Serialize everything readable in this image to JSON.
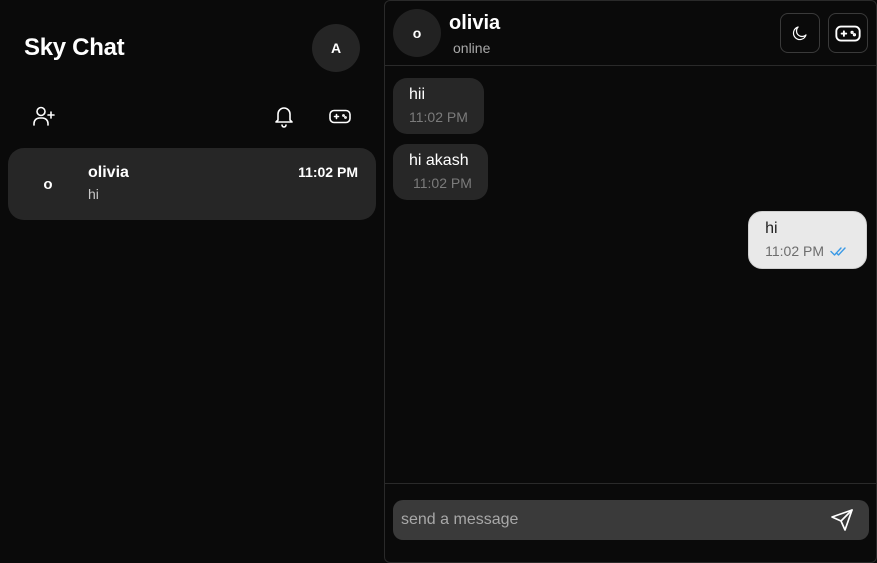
{
  "sidebar": {
    "title": "Sky Chat",
    "avatar_initial": "A",
    "icons": {
      "add_friend": "user-plus-icon",
      "notifications": "bell-icon",
      "games": "gamepad-icon"
    },
    "conversations": [
      {
        "initial": "o",
        "name": "olivia",
        "preview": "hi",
        "time": "11:02 PM"
      }
    ]
  },
  "chat": {
    "header": {
      "initial": "o",
      "name": "olivia",
      "status": "online",
      "icons": {
        "theme": "moon-icon",
        "games": "gamepad-icon"
      }
    },
    "messages": [
      {
        "direction": "incoming",
        "text": "hii",
        "time": "11:02 PM"
      },
      {
        "direction": "incoming",
        "text": "hi akash",
        "time": "11:02 PM"
      },
      {
        "direction": "outgoing",
        "text": "hi",
        "time": "11:02 PM",
        "read_receipt": "double-check-icon"
      }
    ],
    "composer": {
      "placeholder": "send a message",
      "value": "",
      "send_icon": "send-icon"
    }
  },
  "colors": {
    "background": "#0a0a0a",
    "incoming_bubble": "#272727",
    "outgoing_bubble": "#e9e9e9",
    "read_receipt": "#3b9ae6",
    "composer": "#3a3a3a"
  }
}
